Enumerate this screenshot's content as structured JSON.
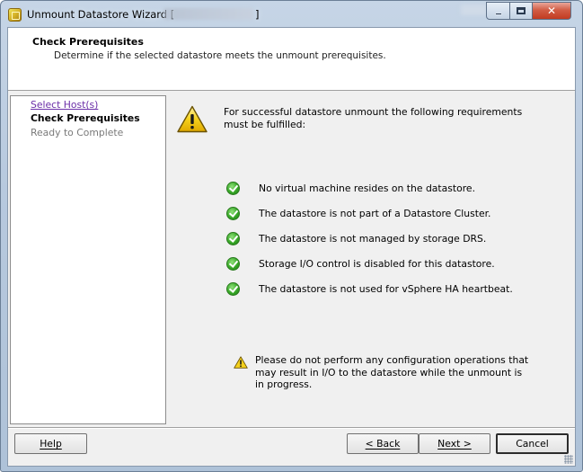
{
  "window": {
    "title": "Unmount Datastore Wizard [",
    "title_suffix": "]",
    "controls": {
      "minimize": "minimize",
      "maximize": "maximize",
      "close": "✕"
    }
  },
  "header": {
    "title": "Check Prerequisites",
    "subtitle": "Determine if the selected datastore meets the unmount prerequisites."
  },
  "steps": [
    {
      "label": "Select Host(s)",
      "state": "completed-link"
    },
    {
      "label": "Check Prerequisites",
      "state": "current"
    },
    {
      "label": "Ready to Complete",
      "state": "pending"
    }
  ],
  "content": {
    "intro": "For successful datastore unmount the following requirements must be fulfilled:",
    "requirements": [
      "No virtual machine resides on the datastore.",
      "The datastore is not part of a Datastore Cluster.",
      "The datastore is not managed by storage DRS.",
      "Storage I/O control is disabled for this datastore.",
      "The datastore is not used for vSphere HA heartbeat."
    ],
    "note": "Please do not perform any configuration operations that may result in I/O to the datastore while the unmount is in progress."
  },
  "buttons": {
    "help": "Help",
    "back": "< Back",
    "next": "Next >",
    "cancel": "Cancel"
  },
  "icons": {
    "app": "vsphere-client-icon",
    "warning": "warning-triangle-icon",
    "check": "green-check-icon"
  },
  "colors": {
    "link": "#6b2fa8",
    "check_green": "#37a827",
    "warning_yellow": "#f5d11d"
  }
}
